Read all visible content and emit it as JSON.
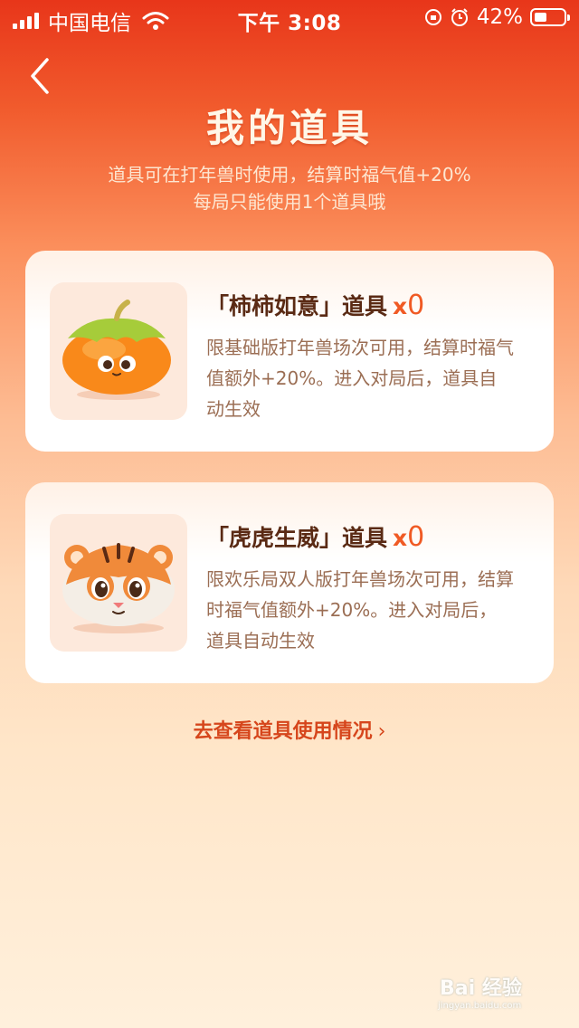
{
  "status_bar": {
    "carrier": "中国电信",
    "time": "下午 3:08",
    "battery": "42%",
    "battery_level": 0.42
  },
  "header": {
    "back_icon": "chevron-left-icon",
    "title": "我的道具",
    "subtitle_line1": "道具可在打年兽时使用，结算时福气值+20%",
    "subtitle_line2": "每局只能使用1个道具哦"
  },
  "items": [
    {
      "name_label": "「柿柿如意」道具",
      "x_label": "x",
      "count": "0",
      "icon": "persimmon-icon",
      "desc": "限基础版打年兽场次可用，结算时福气值额外+20%。进入对局后，道具自动生效"
    },
    {
      "name_label": "「虎虎生威」道具",
      "x_label": "x",
      "count": "0",
      "icon": "tiger-icon",
      "desc": "限欢乐局双人版打年兽场次可用，结算时福气值额外+20%。进入对局后，道具自动生效"
    }
  ],
  "footer": {
    "link_label": "去查看道具使用情况",
    "chevron": "›"
  },
  "watermark": {
    "text": "Bai 经验",
    "subtext": "jingyan.baidu.com"
  },
  "colors": {
    "accent": "#f05a24",
    "title_text": "#5a2a14",
    "desc_text": "#9b6e54",
    "link": "#d6461c"
  }
}
